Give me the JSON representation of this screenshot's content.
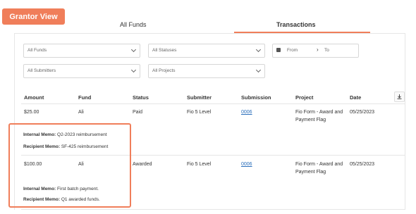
{
  "badge": "Grantor View",
  "tabs": [
    {
      "label": "All Funds",
      "active": false
    },
    {
      "label": "Transactions",
      "active": true
    }
  ],
  "filters": {
    "funds": "All Funds",
    "statuses": "All Statuses",
    "date_from": "From",
    "date_to": "To",
    "submitters": "All Submitters",
    "projects": "All Projects"
  },
  "table": {
    "headers": [
      "Amount",
      "Fund",
      "Status",
      "Submitter",
      "Submission",
      "Project",
      "Date"
    ],
    "rows": [
      {
        "amount": "$25.00",
        "fund": "Ali",
        "status": "Paid",
        "submitter": "Fio 5 Level",
        "submission": "0006",
        "project": [
          "Fio Form - Award and",
          "Payment Flag"
        ],
        "date": "05/25/2023",
        "memos": [
          {
            "label": "Internal Memo:",
            "value": "Q2-2023 reimbursement"
          },
          {
            "label": "Recipient Memo:",
            "value": "SF-425 reimbursement"
          }
        ]
      },
      {
        "amount": "$100.00",
        "fund": "Ali",
        "status": "Awarded",
        "submitter": "Fio 5 Level",
        "submission": "0006",
        "project": [
          "Fio Form - Award and",
          "Payment Flag"
        ],
        "date": "05/25/2023",
        "memos": [
          {
            "label": "Internal Memo:",
            "value": "First batch payment."
          },
          {
            "label": "Recipient Memo:",
            "value": "Q1 awarded funds."
          }
        ]
      }
    ]
  },
  "colors": {
    "accent": "#f07e5a",
    "link": "#2a6ebb"
  },
  "icons": {
    "download": "download-icon",
    "calendar": "calendar-icon",
    "chevron": "chevron-down-icon"
  }
}
